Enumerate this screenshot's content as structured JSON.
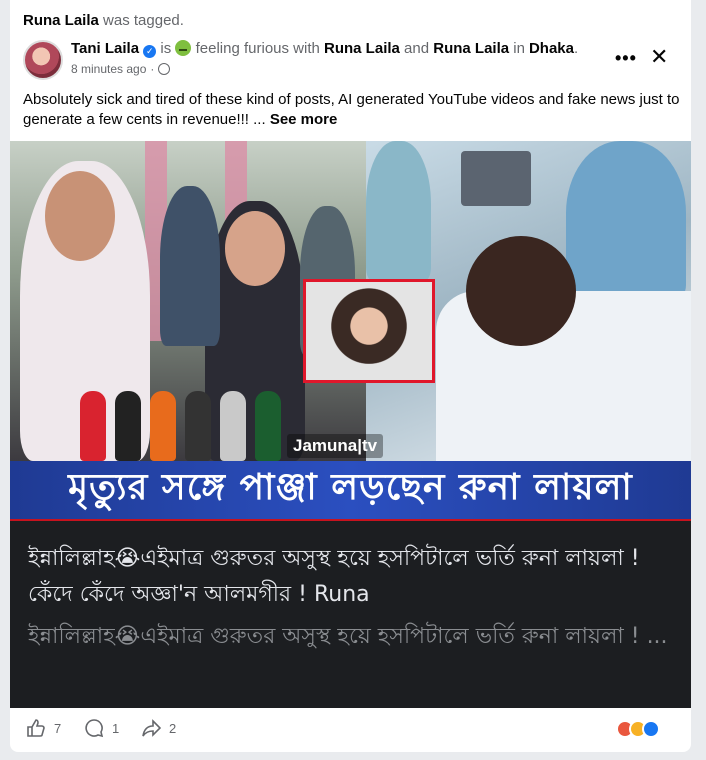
{
  "tagged": {
    "name": "Runa Laila",
    "suffix": "was tagged."
  },
  "author": {
    "name": "Tani Laila",
    "is_text": "is",
    "feeling": "feeling furious with",
    "tag1": "Runa Laila",
    "and_text": "and",
    "tag2": "Runa Laila",
    "in_text": "in",
    "location": "Dhaka",
    "period": "."
  },
  "meta": {
    "time": "8 minutes ago",
    "separator": "·"
  },
  "header_actions": {
    "more": "•••",
    "close": "✕"
  },
  "post": {
    "text": "Absolutely sick and tired of these kind of posts, AI generated YouTube videos and fake news just to generate a few cents in revenue!!! ...",
    "see_more": "See more"
  },
  "media": {
    "logo": "Jamuna|tv",
    "banner": "মৃত্যুর সঙ্গে পাঞ্জা লড়ছেন রুনা লায়লা",
    "caption1": "ইন্নালিল্লাহ😭এইমাত্র গুরুতর অসুস্থ হয়ে হসপিটালে ভর্তি রুনা লায়লা ! কেঁদে কেঁদে অজ্ঞা'ন আলমগীর ! Runa",
    "caption2": "ইন্নালিল্লাহ😭এইমাত্র গুরুতর অসুস্থ হয়ে হসপিটালে ভর্তি রুনা লায়লা ! ..."
  },
  "footer": {
    "likes": "7",
    "comments": "1",
    "shares": "2"
  },
  "colors": {
    "accent": "#1877f2",
    "banner": "#1f3a93",
    "red": "#e0172b"
  }
}
